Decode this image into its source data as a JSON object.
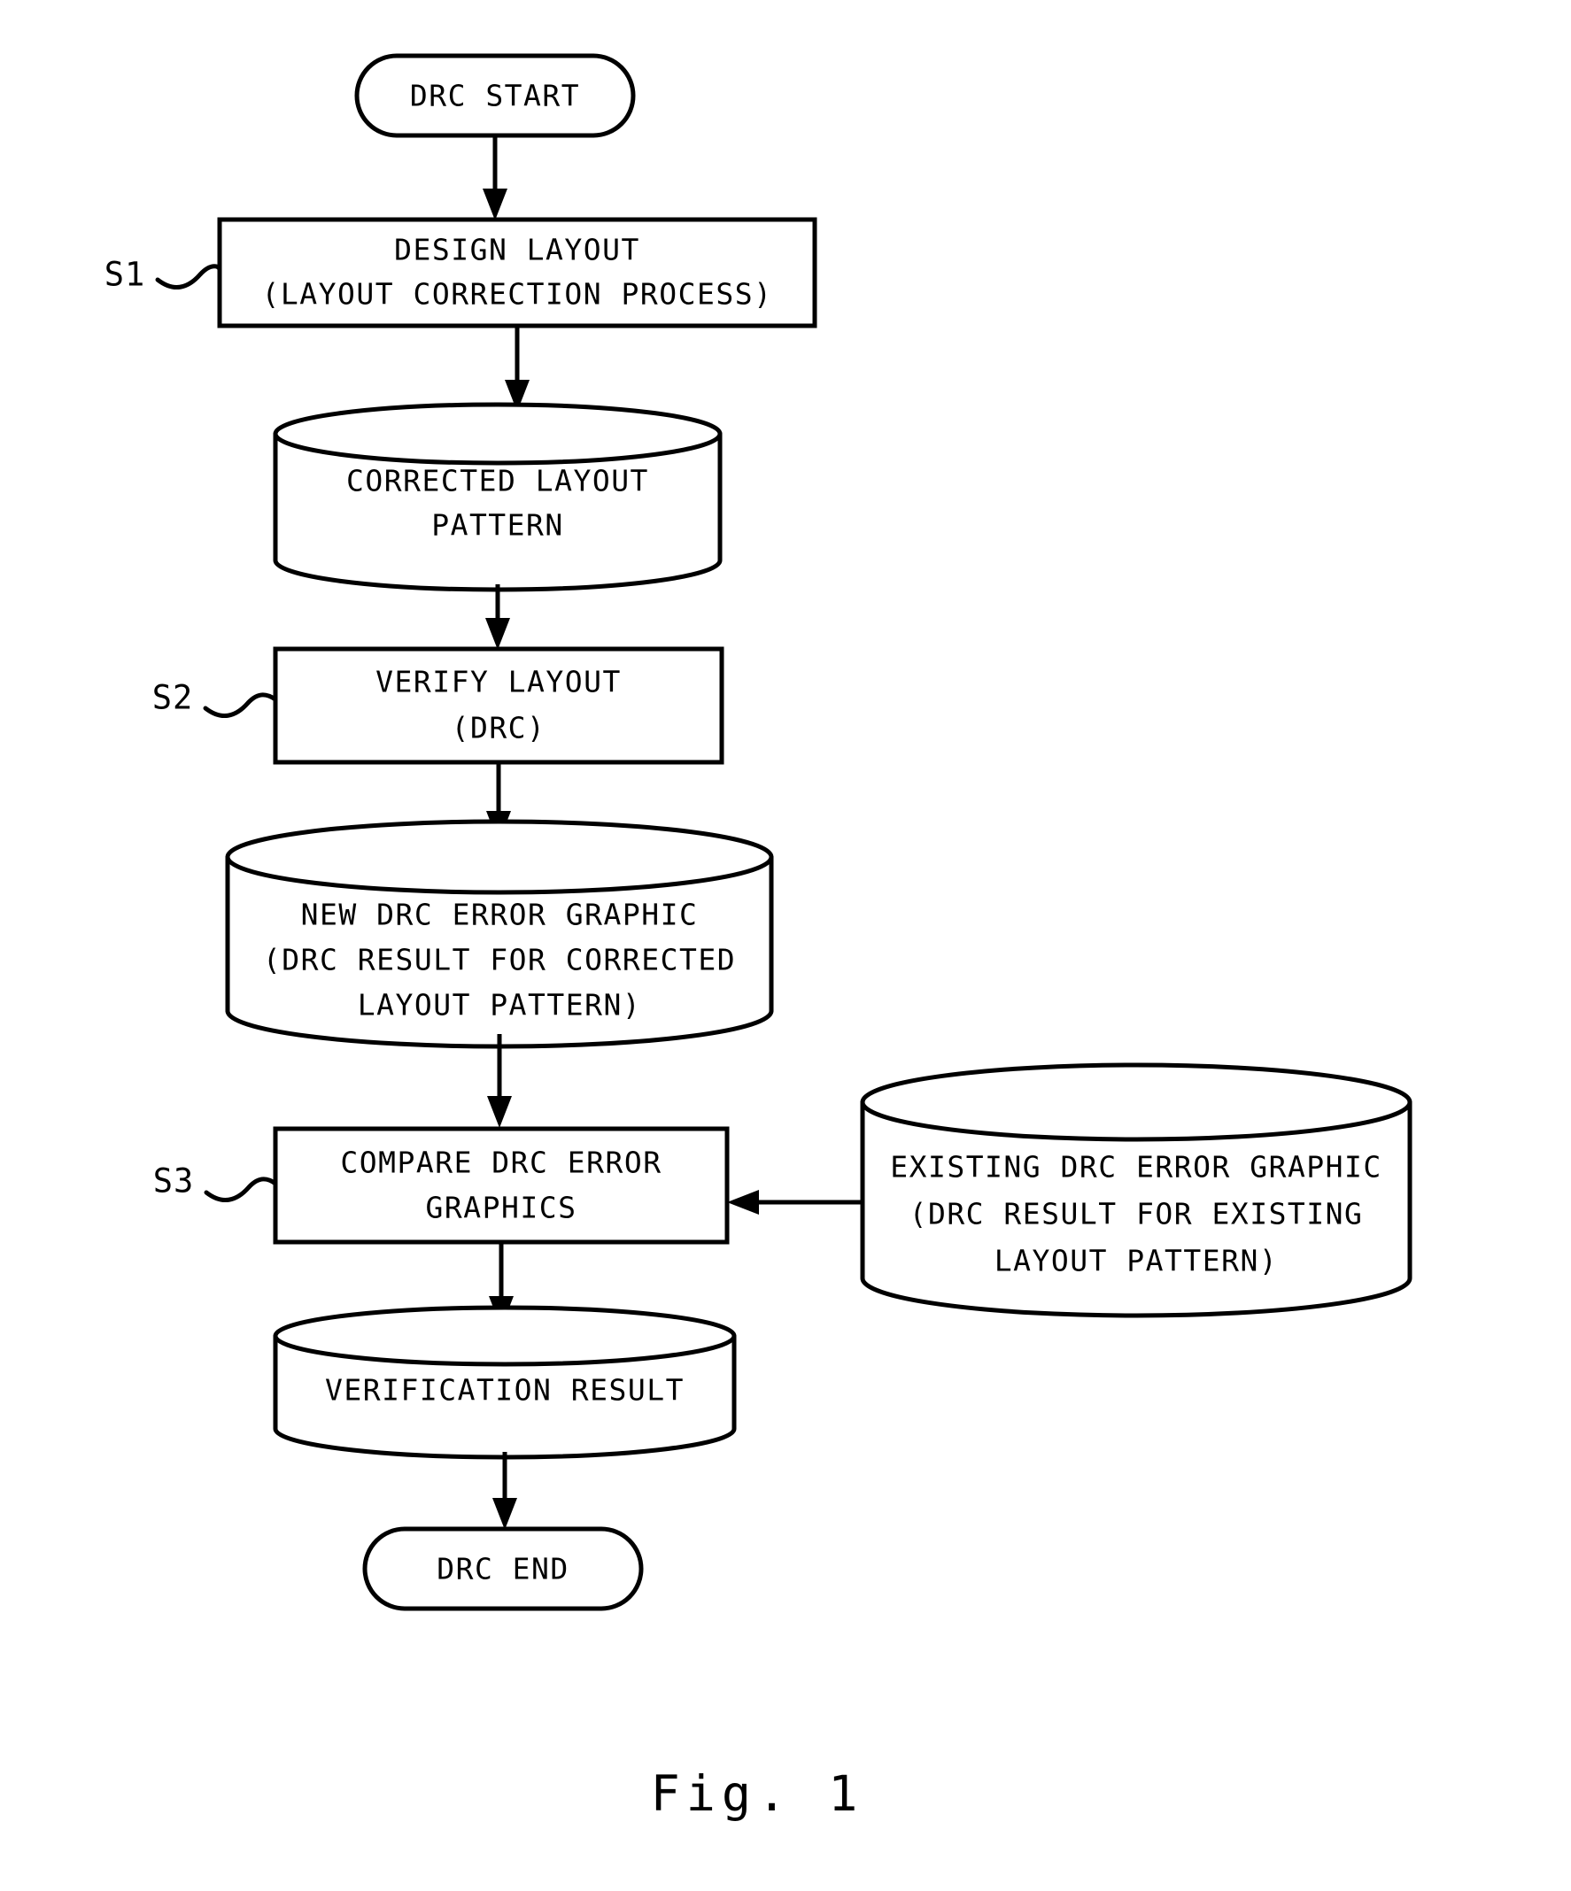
{
  "figure": {
    "caption": "Fig. 1",
    "title_note": "DRC verification flowchart"
  },
  "nodes": {
    "start": {
      "shape": "terminal",
      "label": "DRC START"
    },
    "s1_process": {
      "shape": "process",
      "step_id": "S1",
      "line1": "DESIGN LAYOUT",
      "line2": "(LAYOUT CORRECTION PROCESS)"
    },
    "corrected_layout_data": {
      "shape": "cylinder",
      "line1": "CORRECTED LAYOUT",
      "line2": "PATTERN"
    },
    "s2_process": {
      "shape": "process",
      "step_id": "S2",
      "line1": "VERIFY LAYOUT",
      "line2": "(DRC)"
    },
    "new_drc_error_data": {
      "shape": "cylinder",
      "line1": "NEW DRC ERROR GRAPHIC",
      "line2": "(DRC RESULT FOR CORRECTED",
      "line3": "LAYOUT PATTERN)"
    },
    "s3_process": {
      "shape": "process",
      "step_id": "S3",
      "line1": "COMPARE DRC ERROR",
      "line2": "GRAPHICS"
    },
    "existing_drc_error_data": {
      "shape": "cylinder",
      "line1": "EXISTING DRC ERROR GRAPHIC",
      "line2": "(DRC RESULT FOR EXISTING",
      "line3": "LAYOUT PATTERN)"
    },
    "verification_result_data": {
      "shape": "cylinder",
      "line1": "VERIFICATION RESULT"
    },
    "end": {
      "shape": "terminal",
      "label": "DRC END"
    }
  },
  "colors": {
    "stroke": "#000000",
    "fill": "#ffffff",
    "background": "#ffffff"
  }
}
